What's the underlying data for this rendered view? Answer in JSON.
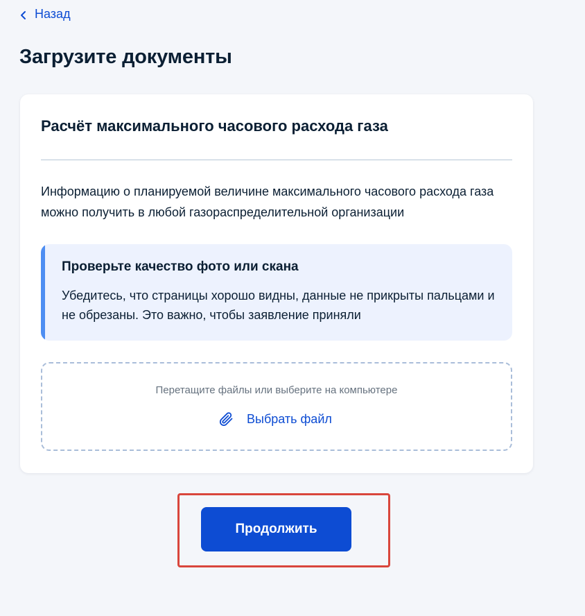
{
  "nav": {
    "back_label": "Назад"
  },
  "page": {
    "title": "Загрузите документы"
  },
  "card": {
    "title": "Расчёт максимального часового расхода газа",
    "info_text": "Информацию о планируемой величине максимального часового расхода газа можно получить в любой газораспределительной организации"
  },
  "notice": {
    "title": "Проверьте качество фото или скана",
    "text": "Убедитесь, что страницы хорошо видны, данные не прикрыты пальцами и не обрезаны. Это важно, чтобы заявление приняли"
  },
  "upload": {
    "hint": "Перетащите файлы или выберите на компьютере",
    "choose_label": "Выбрать файл"
  },
  "actions": {
    "continue_label": "Продолжить"
  },
  "icons": {
    "back": "chevron-left-icon",
    "attach": "paperclip-icon"
  },
  "colors": {
    "accent": "#0d4cd3",
    "notice_bg": "#edf2fe",
    "notice_bar": "#4e8ef2",
    "highlight": "#d9463c",
    "page_bg": "#f4f6fa"
  }
}
